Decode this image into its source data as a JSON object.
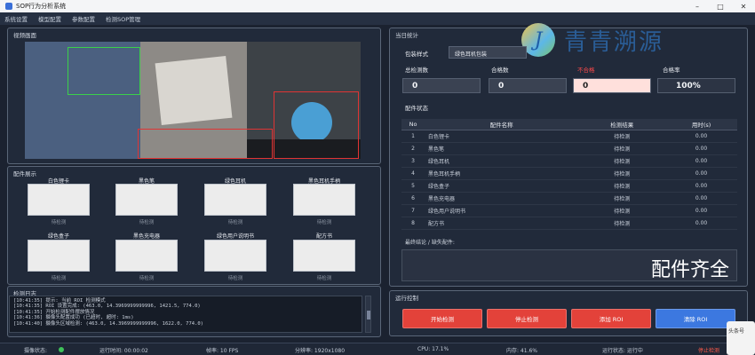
{
  "window": {
    "title": "SOP行为分析系统"
  },
  "menu": [
    "系统设置",
    "模型配置",
    "参数配置",
    "检测SOP管理"
  ],
  "video_panel": {
    "title": "视频画面"
  },
  "parts_panel": {
    "title": "配件展示",
    "items": [
      {
        "label": "白色锂卡",
        "status": "待检测"
      },
      {
        "label": "黑色笔",
        "status": "待检测"
      },
      {
        "label": "绿色耳机",
        "status": "待检测"
      },
      {
        "label": "黑色耳机手柄",
        "status": "待检测"
      },
      {
        "label": "绿色盒子",
        "status": "待检测"
      },
      {
        "label": "黑色充电器",
        "status": "待检测"
      },
      {
        "label": "绿色用户说明书",
        "status": "待检测"
      },
      {
        "label": "配方书",
        "status": "待检测"
      }
    ]
  },
  "log_panel": {
    "title": "检测日志",
    "lines": [
      "[10:41:35] 提示: 当前 ROI 检测模式",
      "[10:41:35] ROI 设置完成: (463.0, 14.3969999999996, 1421.5, 774.0)",
      "[10:41:35] 开始检测配件摆放情况",
      "[10:41:36] 摄像头配置成功 (已超时, 超时: 1ms)",
      "[10:41:40] 摄像头区域检测: (463.0, 14.3969999999996, 1622.0, 774.0)"
    ]
  },
  "stats_panel": {
    "title": "当日统计",
    "pack_label": "包装样式",
    "pack_value": "绿色耳机包装",
    "total_label": "总检测数",
    "total_value": "0",
    "ok_label": "合格数",
    "ok_value": "0",
    "ng_label": "不合格",
    "ng_value": "0",
    "rate_label": "合格率",
    "rate_value": "100%",
    "ng_label_color": "#ff4a4a"
  },
  "parts_status": {
    "title": "配件状态",
    "columns": [
      "No",
      "配件名称",
      "检测结果",
      "用时(s)"
    ],
    "rows": [
      [
        "1",
        "白色锂卡",
        "待检测",
        "0.00"
      ],
      [
        "2",
        "黑色笔",
        "待检测",
        "0.00"
      ],
      [
        "3",
        "绿色耳机",
        "待检测",
        "0.00"
      ],
      [
        "4",
        "黑色耳机手柄",
        "待检测",
        "0.00"
      ],
      [
        "5",
        "绿色盒子",
        "待检测",
        "0.00"
      ],
      [
        "6",
        "黑色充电器",
        "待检测",
        "0.00"
      ],
      [
        "7",
        "绿色用户说明书",
        "待检测",
        "0.00"
      ],
      [
        "8",
        "配方书",
        "待检测",
        "0.00"
      ]
    ],
    "result_caption": "最终结论 / 缺失配件:",
    "result_text": "配件齐全"
  },
  "control_panel": {
    "title": "运行控制",
    "buttons": [
      "开始检测",
      "停止检测",
      "添加 ROI",
      "清除 ROI"
    ]
  },
  "statusbar": {
    "camera": "摄像状态:",
    "runtime": "运行时间: 00:00:02",
    "fps": "帧率: 10 FPS",
    "resolution": "分辨率: 1920x1080",
    "cpu": "CPU: 17.1%",
    "memory": "内存: 41.6%",
    "run_state": "运行状态: 运行中",
    "stop": "停止检测"
  },
  "watermark": {
    "letter": "J",
    "text": "青青溯源"
  },
  "corner_logo": {
    "text": "头条号"
  },
  "colors": {
    "accent_red": "#e3423a",
    "accent_blue": "#3c78e0",
    "background": "#1b2230"
  }
}
